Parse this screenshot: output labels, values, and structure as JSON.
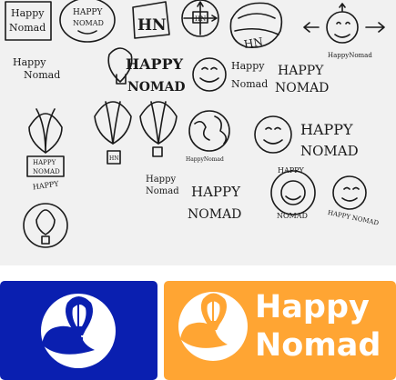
{
  "sketch": {
    "labels": {
      "happy_nomad_box": [
        "Happy",
        "Nomad"
      ],
      "happy_nomad_oval": [
        "HAPPY",
        "NOMAD"
      ],
      "hn_square": "HN",
      "hn_circle": "HN",
      "hn_tilted": "HN",
      "happy_nomad_small": "HappyNomad",
      "happy_nomad_script": [
        "Happy",
        "Nomad"
      ],
      "happy_nomad_caps": [
        "HAPPY",
        "NOMAD"
      ],
      "happy_nomad_face": [
        "Happy",
        "Nomad"
      ],
      "happy_nomad_outlined": [
        "HAPPY",
        "NOMAD"
      ],
      "balloon_hn": "HN",
      "balloon_basket": [
        "HAPPY",
        "NOMAD"
      ],
      "earth_caption": "HappyNomad",
      "bold_outline": [
        "HAPPY",
        "NOMAD"
      ],
      "happy_nomad_stacked": [
        "Happy",
        "Nomad"
      ],
      "happy_nomad_big": [
        "HAPPY",
        "NOMAD"
      ],
      "arc_top": "HAPPY",
      "arc_bottom": "NOMAD",
      "arc_right": "HAPPY NOMAD"
    }
  },
  "logos": {
    "blue_bg": "#0a1fb0",
    "orange_bg": "#ffa533",
    "mark_color": "#ffffff",
    "brand_name": [
      "Happy",
      "Nomad"
    ]
  }
}
